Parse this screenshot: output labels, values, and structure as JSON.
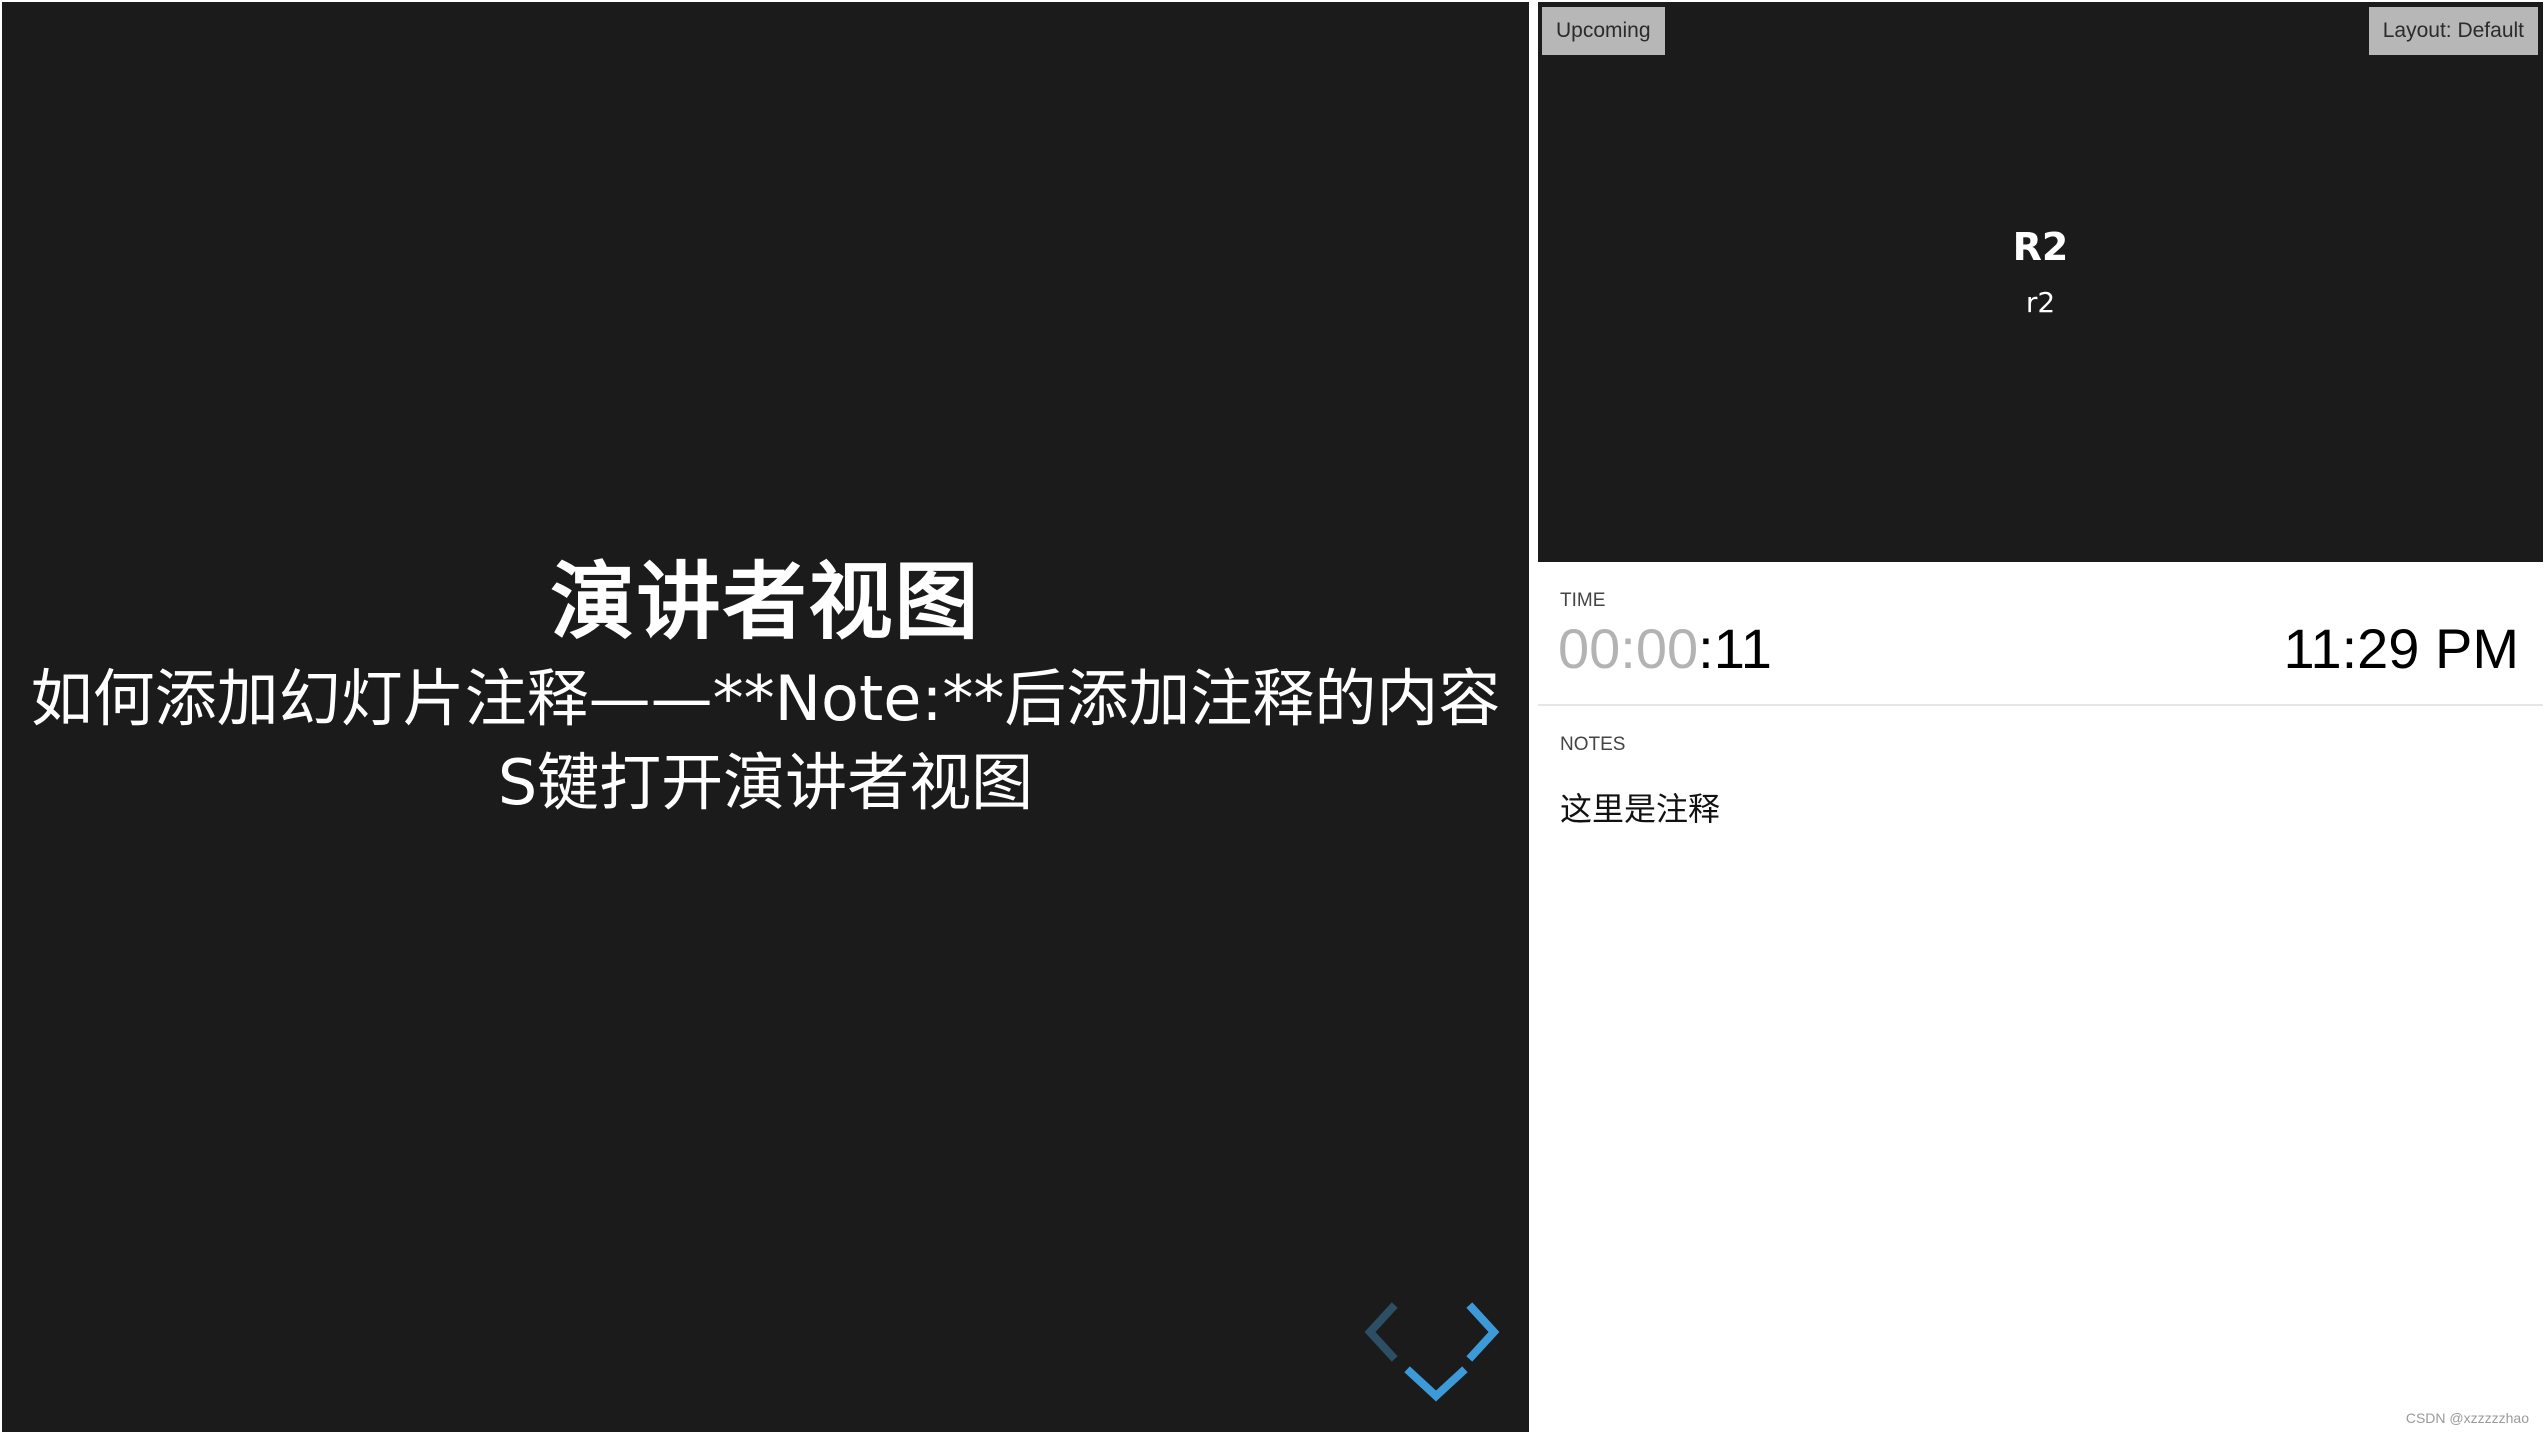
{
  "current_slide": {
    "title": "演讲者视图",
    "lines": [
      "如何添加幻灯片注释——**Note:**后添加注释的内容",
      "S键打开演讲者视图"
    ]
  },
  "navigation": {
    "left_icon": "chevron-left-icon",
    "right_icon": "chevron-right-icon",
    "down_icon": "chevron-down-icon",
    "active_color": "#3d9ad8",
    "disabled_color": "#2d4f66"
  },
  "upcoming": {
    "label": "Upcoming",
    "layout_button": "Layout: Default",
    "slide_title": "R2",
    "slide_subtitle": "r2"
  },
  "time": {
    "label": "TIME",
    "elapsed_muted": "00:00",
    "elapsed_active": ":11",
    "clock": "11:29 PM"
  },
  "notes": {
    "label": "NOTES",
    "text": "这里是注释"
  },
  "watermark": "CSDN @xzzzzzhao",
  "colors": {
    "slide_bg": "#1c1b1b",
    "badge_bg": "#b7b7b7"
  }
}
